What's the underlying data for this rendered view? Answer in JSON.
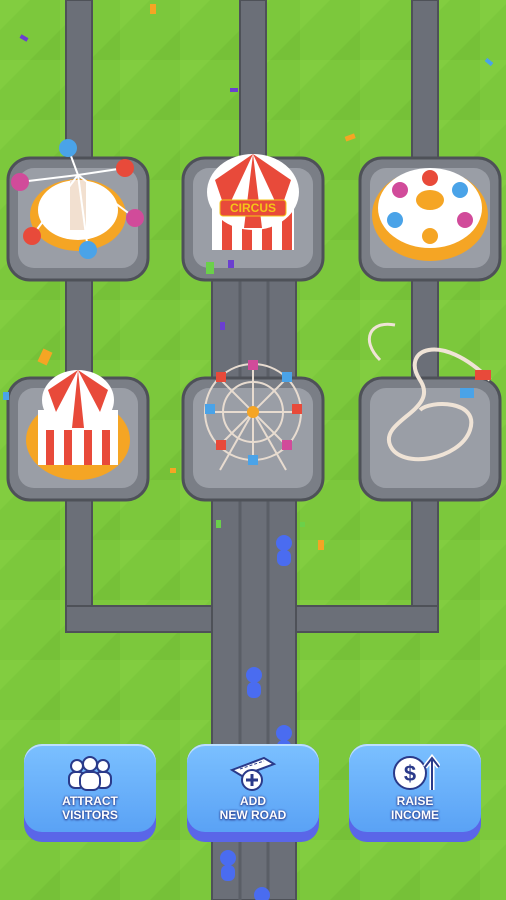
{
  "colors": {
    "grass": "#7cc83c",
    "road": "#6b6f78",
    "button": "#6aaef8",
    "button_shadow": "#5a66e8",
    "stripe_red": "#e84a3a",
    "stripe_white": "#ffffff"
  },
  "scene": {
    "rides": [
      {
        "name": "swing-ride",
        "icon": "swing-ride-icon"
      },
      {
        "name": "circus-tent",
        "icon": "circus-tent-icon",
        "sign": "CIRCUS"
      },
      {
        "name": "teacup-ride",
        "icon": "teacup-ride-icon"
      },
      {
        "name": "carousel",
        "icon": "carousel-icon"
      },
      {
        "name": "ferris-wheel",
        "icon": "ferris-wheel-icon"
      },
      {
        "name": "roller-coaster",
        "icon": "roller-coaster-icon"
      }
    ],
    "visitors": 5
  },
  "buttons": {
    "attract": {
      "label": "ATTRACT\nVISITORS",
      "icon": "visitors-icon"
    },
    "road": {
      "label": "ADD\nNEW ROAD",
      "icon": "road-plus-icon"
    },
    "income": {
      "label": "RAISE\nINCOME",
      "icon": "dollar-up-icon"
    }
  }
}
